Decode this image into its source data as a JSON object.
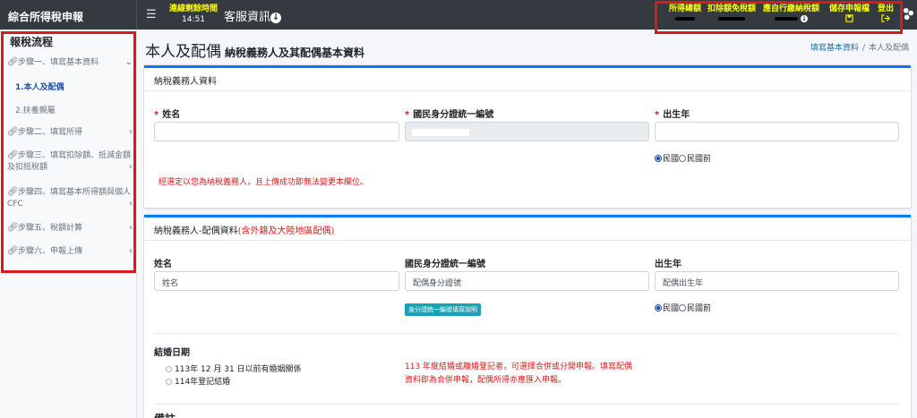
{
  "app": {
    "brand": "綜合所得稅申報",
    "timer_label": "連線剩餘時間",
    "timer_value": "14:51",
    "service_label": "客服資訊"
  },
  "top_menu": {
    "items": [
      {
        "label": "所得總額"
      },
      {
        "label": "扣除額免稅額"
      },
      {
        "label": "應自行繳納稅額"
      },
      {
        "label": "儲存申報檔",
        "icon": "save-icon"
      },
      {
        "label": "登出",
        "icon": "logout-icon"
      }
    ]
  },
  "sidebar": {
    "title": "報稅流程",
    "steps": [
      {
        "label": "步驟一、填寫基本資料",
        "expanded": true
      },
      {
        "label": "步驟二、填寫所得"
      },
      {
        "label": "步驟三、填寫扣除額、抵減金額及扣抵稅額"
      },
      {
        "label": "步驟四、填寫基本所得額與個人CFC"
      },
      {
        "label": "步驟五、稅額計算"
      },
      {
        "label": "步驟六、申報上傳"
      }
    ],
    "sub_items": [
      {
        "label": "1.本人及配偶",
        "active": true
      },
      {
        "label": "2.扶養親屬"
      }
    ]
  },
  "page": {
    "title": "本人及配偶",
    "subtitle": "納稅義務人及其配偶基本資料",
    "breadcrumb": [
      "填寫基本資料",
      "本人及配偶"
    ]
  },
  "taxpayer": {
    "header": "納稅義務人資料",
    "name_label": "姓名",
    "id_label": "國民身分證統一編號",
    "birth_label": "出生年",
    "name_value": "",
    "birth_value": "",
    "era_options": [
      "民國",
      "民國前"
    ],
    "notice": "經選定以您為納稅義務人，且上傳成功即無法變更本欄位。"
  },
  "spouse": {
    "header": "納稅義務人-配偶資料",
    "header_note": "(含外籍及大陸地區配偶)",
    "name_label": "姓名",
    "id_label": "國民身分證統一編號",
    "birth_label": "出生年",
    "name_placeholder": "姓名",
    "id_placeholder": "配偶身分證號",
    "birth_placeholder": "配偶出生年",
    "id_help_badge": "身分證統一編號填寫說明",
    "era_options": [
      "民國",
      "民國前"
    ],
    "marriage_label": "結婚日期",
    "marriage_options": [
      "113年 12 月 31 日以前有婚姻關係",
      "114年登記結婚"
    ],
    "marriage_notice_line1": "113 年度結婚或離婚登記者，可選擇合併或分開申報。填寫配偶",
    "marriage_notice_line2": "資料即為合併申報，配偶所得亦應匯入申報。",
    "next_section": "備註"
  },
  "colors": {
    "topbar": "#343a40",
    "accent_yellow": "#ffff00",
    "highlight_red": "#d81a1a",
    "primary_blue": "#007bff",
    "badge_teal": "#17a2b8"
  }
}
